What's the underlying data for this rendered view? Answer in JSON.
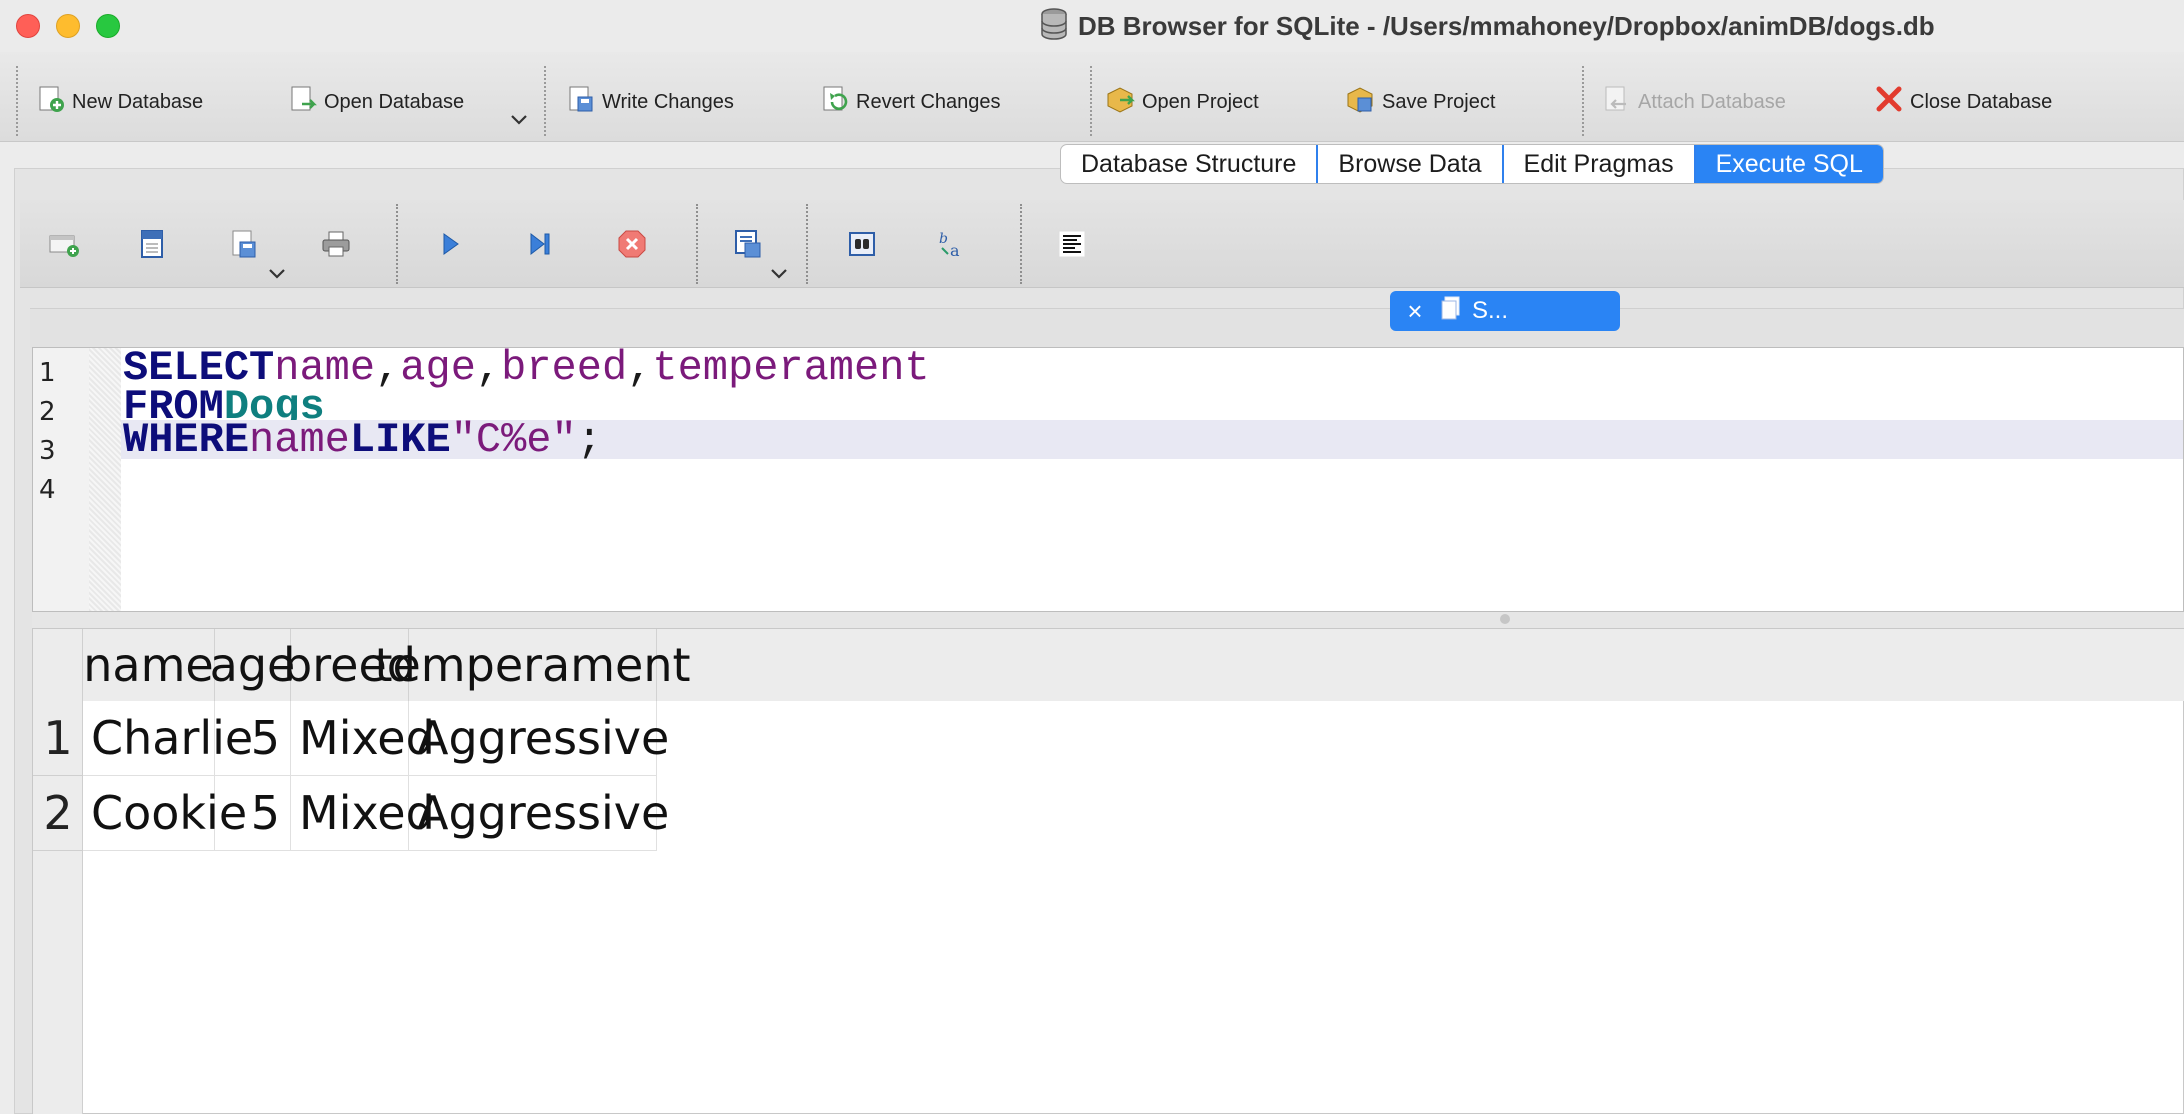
{
  "window": {
    "title": "DB Browser for SQLite - /Users/mmahoney/Dropbox/animDB/dogs.db"
  },
  "toolbar": {
    "new_database": "New Database",
    "open_database": "Open Database",
    "write_changes": "Write Changes",
    "revert_changes": "Revert Changes",
    "open_project": "Open Project",
    "save_project": "Save Project",
    "attach_database": "Attach Database",
    "close_database": "Close Database"
  },
  "tabs": [
    {
      "label": "Database Structure",
      "active": false
    },
    {
      "label": "Browse Data",
      "active": false
    },
    {
      "label": "Edit Pragmas",
      "active": false
    },
    {
      "label": "Execute SQL",
      "active": true
    }
  ],
  "editor_tab": {
    "label": "S..."
  },
  "editor": {
    "line_numbers": [
      "1",
      "2",
      "3",
      "4"
    ],
    "line1": {
      "kw": "SELECT",
      "c1": "name",
      "c2": "age",
      "c3": "breed",
      "c4": "temperament",
      "comma": ","
    },
    "line2": {
      "kw": "FROM",
      "table": "Dogs"
    },
    "line3": {
      "kw1": "WHERE",
      "col": "name",
      "kw2": "LIKE",
      "str": "\"C%e\"",
      "semi": ";"
    }
  },
  "results": {
    "columns": [
      "name",
      "age",
      "breed",
      "temperament"
    ],
    "rows": [
      {
        "num": "1",
        "name": "Charlie",
        "age": "5",
        "breed": "Mixed",
        "temperament": "Aggressive"
      },
      {
        "num": "2",
        "name": "Cookie",
        "age": "5",
        "breed": "Mixed",
        "temperament": "Aggressive"
      }
    ]
  },
  "colors": {
    "accent": "#2a84f4",
    "keyword": "#0d0d7a",
    "identifier": "#7b1a7b",
    "table": "#0f7f7f"
  }
}
